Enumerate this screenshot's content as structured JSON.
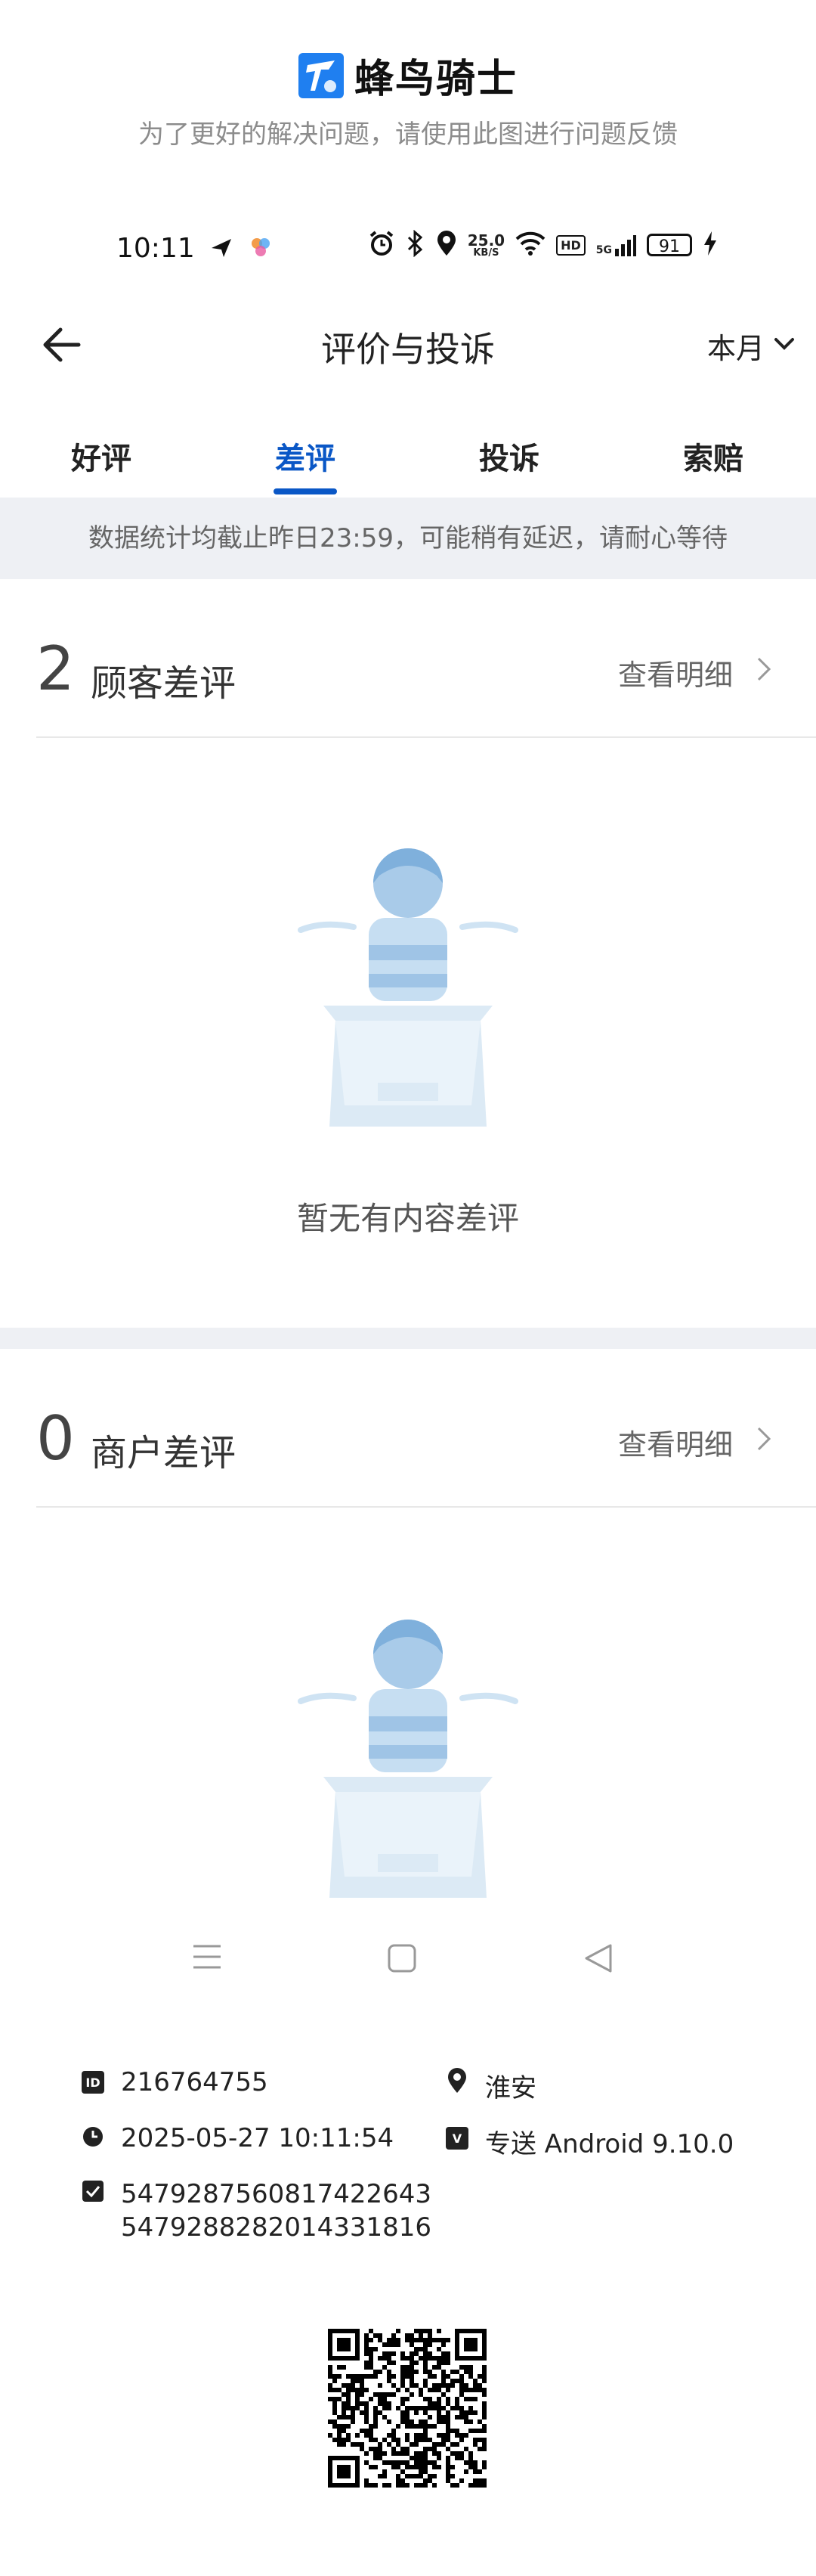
{
  "feedback": {
    "brand_name": "蜂鸟骑士",
    "subtitle": "为了更好的解决问题，请使用此图进行问题反馈"
  },
  "status_bar": {
    "time": "10:11",
    "speed": "25.0",
    "speed_unit": "KB/S",
    "hd": "HD",
    "network": "5G",
    "battery": "91"
  },
  "nav": {
    "title": "评价与投诉",
    "period": "本月"
  },
  "tabs": [
    {
      "label": "好评"
    },
    {
      "label": "差评"
    },
    {
      "label": "投诉"
    },
    {
      "label": "索赔"
    }
  ],
  "notice": "数据统计均截止昨日23:59，可能稍有延迟，请耐心等待",
  "customer_section": {
    "count": "2",
    "label": "顾客差评",
    "more": "查看明细",
    "empty_text": "暂无有内容差评"
  },
  "merchant_section": {
    "count": "0",
    "label": "商户差评",
    "more": "查看明细"
  },
  "info": {
    "id": "216764755",
    "location": "淮安",
    "datetime": "2025-05-27 10:11:54",
    "app": "专送 Android 9.10.0",
    "codes": [
      "5479287560817422643",
      "5479288282014331816"
    ]
  },
  "colors": {
    "accent": "#0a57c6",
    "brand": "#1f7ff0",
    "band": "#eef0f4"
  }
}
